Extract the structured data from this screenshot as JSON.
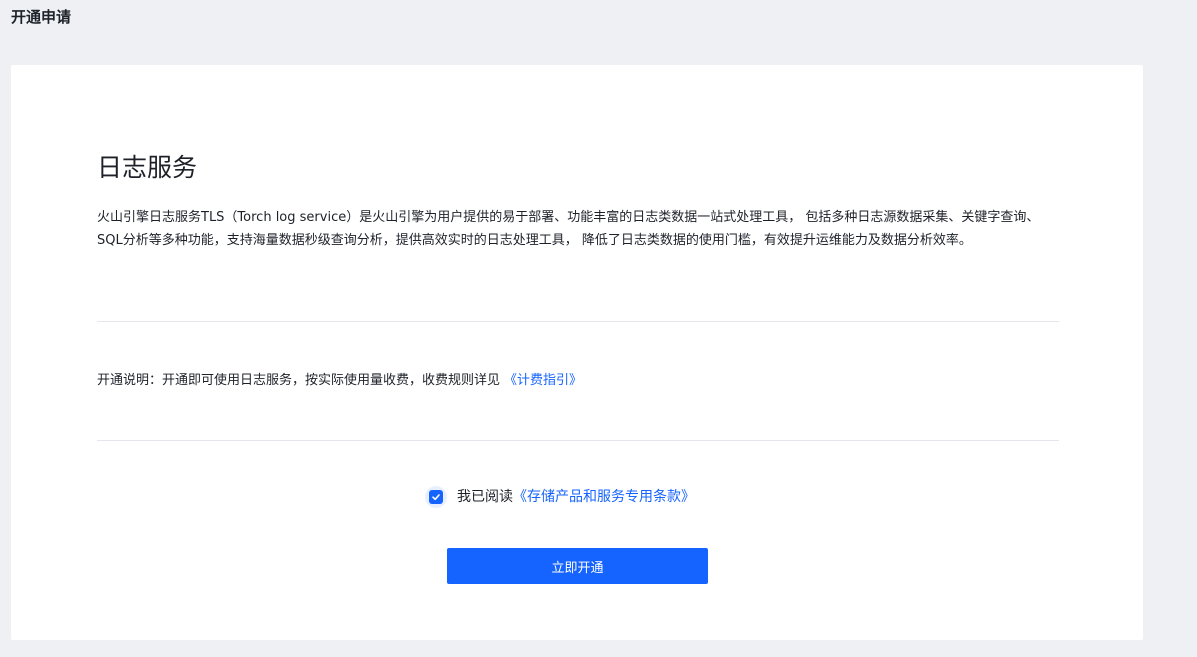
{
  "header": {
    "title": "开通申请"
  },
  "service": {
    "title": "日志服务",
    "description": "火山引擎日志服务TLS（Torch log service）是火山引擎为用户提供的易于部署、功能丰富的日志类数据一站式处理工具， 包括多种日志源数据采集、关键字查询、SQL分析等多种功能，支持海量数据秒级查询分析，提供高效实时的日志处理工具， 降低了日志类数据的使用门槛，有效提升运维能力及数据分析效率。"
  },
  "activation": {
    "note": "开通说明：开通即可使用日志服务，按实际使用量收费，收费规则详见",
    "billing_link": "《计费指引》"
  },
  "agreement": {
    "checked": true,
    "prefix": "我已阅读",
    "link": "《存储产品和服务专用条款》"
  },
  "actions": {
    "activate_label": "立即开通"
  },
  "colors": {
    "primary": "#1664ff",
    "background": "#eef0f4",
    "card": "#ffffff",
    "text": "#1d2129",
    "divider": "#e5e6eb"
  },
  "icons": {
    "checkbox": "check-icon"
  }
}
